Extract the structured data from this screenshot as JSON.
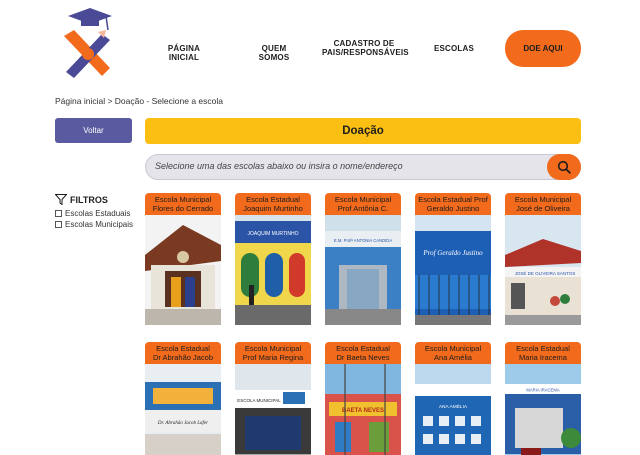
{
  "nav": {
    "home": "PÁGINA INICIAL",
    "about": "QUEM SOMOS",
    "register_line1": "CADASTRO DE",
    "register_line2": "PAIS/RESPONSÁVEIS",
    "schools": "ESCOLAS",
    "donate": "DOE AQUI"
  },
  "breadcrumb": "Página inicial > Doação - Selecione a escola",
  "back_label": "Voltar",
  "page_title": "Doação",
  "search": {
    "placeholder": "Selecione uma das escolas abaixo ou insira o nome/endereço"
  },
  "filters": {
    "title": "FILTROS",
    "options": [
      "Escolas Estaduais",
      "Escolas Municipais"
    ]
  },
  "schools": [
    {
      "line1": "Escola Municipal",
      "line2": "Flores do Cerrado",
      "sign": ""
    },
    {
      "line1": "Escola Estadual",
      "line2": "Joaquim Murtinho",
      "sign": "JOAQUIM MURTINHO"
    },
    {
      "line1": "Escola Municipal",
      "line2": "Prof Antônia C.",
      "sign": "E.M. Profª ANTONIA CANDIDA"
    },
    {
      "line1": "Escola Estadual Prof",
      "line2": "Geraldo Justino",
      "sign": "Prof Geraldo Justino"
    },
    {
      "line1": "Escola Municipal",
      "line2": "José de Oliveira",
      "sign": "JOSÉ DE OLIVEIRA SANTOS"
    },
    {
      "line1": "Escola Estadual",
      "line2": "Dr Abrahão Jacob",
      "sign": "Dr. Abrahão Jacob Lafer"
    },
    {
      "line1": "Escola Municipal",
      "line2": "Prof Maria Regina",
      "sign": "ESCOLA MUNICIPAL"
    },
    {
      "line1": "Escola Estadual",
      "line2": "Dr Baeta Neves",
      "sign": "BAETA NEVES"
    },
    {
      "line1": "Escola Municipal",
      "line2": "Ana Amélia",
      "sign": "ANA AMÉLIA"
    },
    {
      "line1": "Escola Estadual",
      "line2": "Maria Iracema",
      "sign": "MARIA IRACEMA"
    }
  ],
  "colors": {
    "orange": "#f26a1b",
    "yellow": "#fbbf14",
    "purple": "#5a5aa0"
  }
}
